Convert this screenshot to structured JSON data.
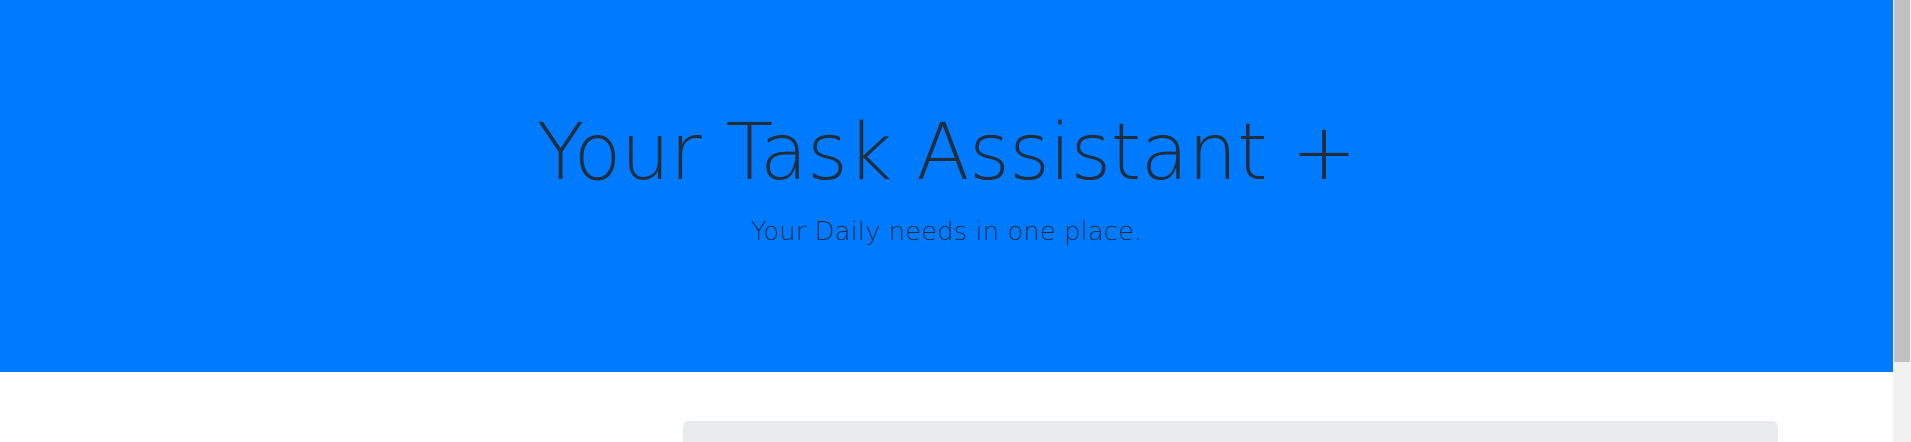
{
  "hero": {
    "title": "Your Task Assistant +",
    "subtitle": "Your Daily needs in one place."
  },
  "colors": {
    "hero_background": "#007bff",
    "text": "#1f2d3d",
    "card_background": "#e9ecef"
  }
}
